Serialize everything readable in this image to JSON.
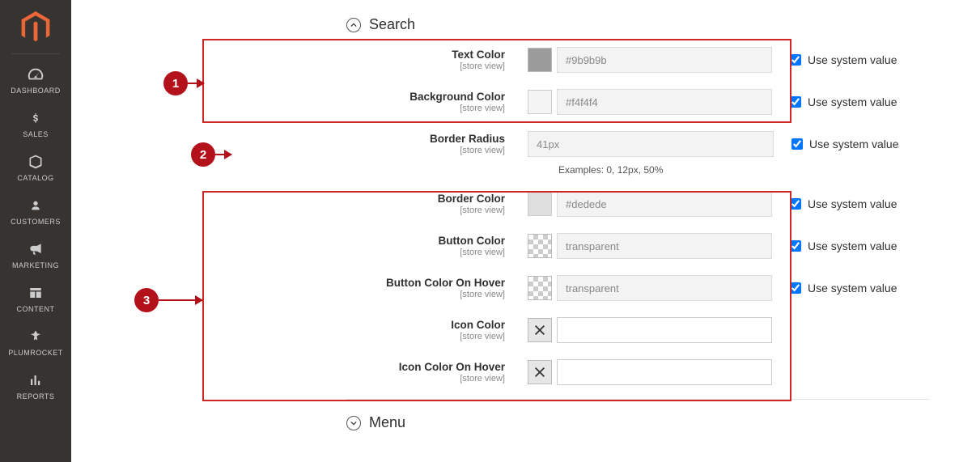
{
  "sidebar": {
    "items": [
      {
        "label": "DASHBOARD"
      },
      {
        "label": "SALES"
      },
      {
        "label": "CATALOG"
      },
      {
        "label": "CUSTOMERS"
      },
      {
        "label": "MARKETING"
      },
      {
        "label": "CONTENT"
      },
      {
        "label": "PLUMROCKET"
      },
      {
        "label": "REPORTS"
      }
    ]
  },
  "sections": {
    "search": {
      "title": "Search"
    },
    "menu": {
      "title": "Menu"
    }
  },
  "callouts": {
    "c1": "1",
    "c2": "2",
    "c3": "3"
  },
  "fields": {
    "scope": "[store view]",
    "text_color": {
      "label": "Text Color",
      "value": "#9b9b9b",
      "swatch": "#9b9b9b",
      "use_system": true,
      "sys_label": "Use system value"
    },
    "background_color": {
      "label": "Background Color",
      "value": "#f4f4f4",
      "swatch": "#f4f4f4",
      "use_system": true,
      "sys_label": "Use system value"
    },
    "border_radius": {
      "label": "Border Radius",
      "value": "41px",
      "helper": "Examples: 0, 12px, 50%",
      "use_system": true,
      "sys_label": "Use system value"
    },
    "border_color": {
      "label": "Border Color",
      "value": "#dedede",
      "swatch": "#dedede",
      "use_system": true,
      "sys_label": "Use system value"
    },
    "button_color": {
      "label": "Button Color",
      "value": "transparent",
      "use_system": true,
      "sys_label": "Use system value"
    },
    "button_hover": {
      "label": "Button Color On Hover",
      "value": "transparent",
      "use_system": true,
      "sys_label": "Use system value"
    },
    "icon_color": {
      "label": "Icon Color",
      "value": ""
    },
    "icon_hover": {
      "label": "Icon Color On Hover",
      "value": ""
    }
  }
}
